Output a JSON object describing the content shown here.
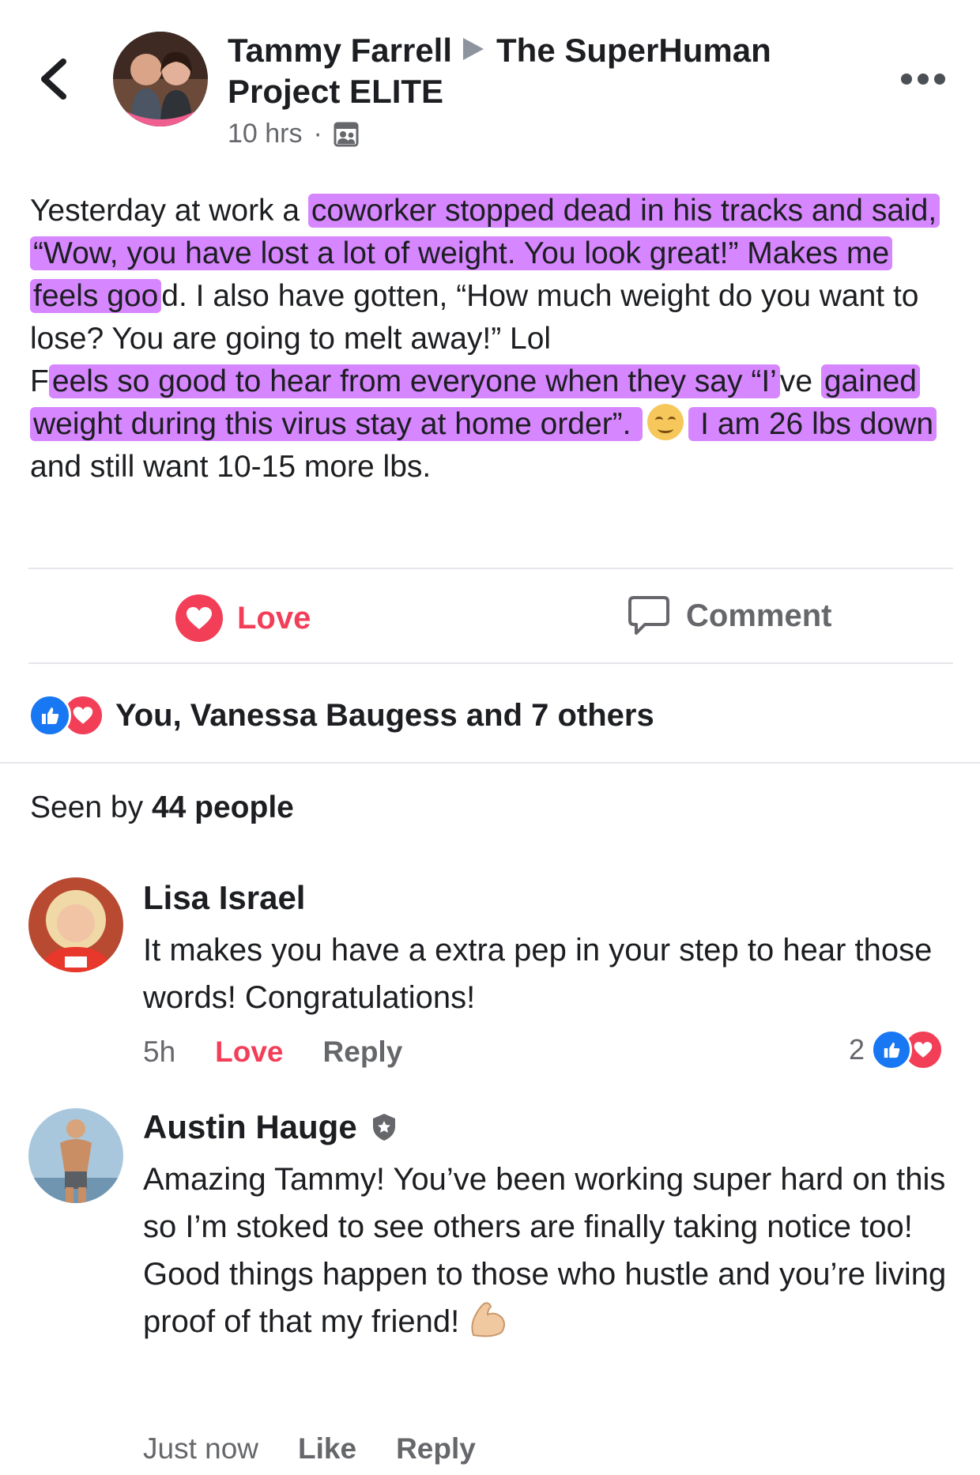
{
  "post": {
    "author": "Tammy Farrell",
    "group": "The SuperHuman Project ELITE",
    "time": "10 hrs",
    "dot": "·",
    "body": {
      "seg1": "Yesterday at work a ",
      "seg2_hl": "coworker stopped dead in his tracks and said, “Wow, you have lost a lot of weight. You look great!”  Makes me feels goo",
      "seg3": "d. I also have gotten, “How much weight do you want to lose? You are going to melt away!” Lol",
      "seg4": "F",
      "seg5_hl": "eels so good to hear from everyone when they say “I’",
      "seg6": "ve ",
      "seg7_hl": "gained weight during this virus stay at home order”. ",
      "seg8_hl": " I am 26 lbs down",
      "seg9": " and still want 10-15 more lbs."
    },
    "highlight_color": "#c657ff"
  },
  "actions": {
    "love": "Love",
    "comment": "Comment"
  },
  "reactions": {
    "summary": "You, Vanessa Baugess and 7 others"
  },
  "seen": {
    "prefix": "Seen by ",
    "count": "44 people"
  },
  "comments": [
    {
      "name": "Lisa Israel",
      "text": "It makes you have a extra pep in your step to hear those words! Congratulations!",
      "time": "5h",
      "love": "Love",
      "reply": "Reply",
      "reaction_count": "2"
    },
    {
      "name": "Austin Hauge",
      "text": "Amazing Tammy! You’ve been working super hard on this so I’m stoked to see others are finally taking notice too! Good things happen to those who hustle and you’re living proof of that my friend!",
      "time": "Just now",
      "like": "Like",
      "reply": "Reply"
    }
  ],
  "colors": {
    "love_red": "#f33e58",
    "like_blue": "#1877f2",
    "secondary_text": "#65676b"
  },
  "icons": {
    "back": "chevron-left-icon",
    "more": "more-horizontal-icon",
    "audience": "group-audience-icon",
    "love": "heart-icon",
    "comment": "comment-bubble-icon",
    "admin_badge": "shield-badge-icon",
    "emoji_smile": "smiling-face-emoji",
    "emoji_muscle": "flexed-biceps-emoji"
  }
}
